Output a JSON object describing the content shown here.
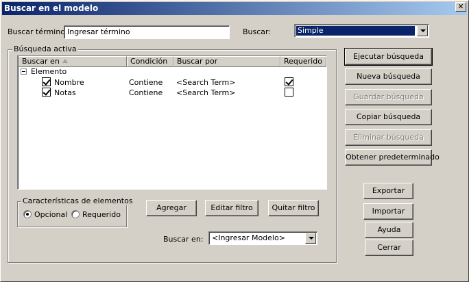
{
  "window": {
    "title": "Buscar en el modelo",
    "close_glyph": "✕"
  },
  "search": {
    "term_label": "Buscar término:",
    "term_value": "Ingresar término",
    "type_label": "Buscar:",
    "type_value": "Simple"
  },
  "active_search": {
    "title": "Búsqueda activa",
    "columns": [
      "Buscar en",
      "Condición",
      "Buscar por",
      "Requerido"
    ],
    "root": {
      "label": "Elemento",
      "expanded": true
    },
    "rows": [
      {
        "field": "Nombre",
        "checked": true,
        "condition": "Contiene",
        "search_by": "<Search Term>",
        "required": true
      },
      {
        "field": "Notas",
        "checked": true,
        "condition": "Contiene",
        "search_by": "<Search Term>",
        "required": false
      }
    ]
  },
  "element_features": {
    "title": "Características de elementos",
    "options": [
      "Opcional",
      "Requerido"
    ],
    "selected": "Opcional"
  },
  "filter_buttons": {
    "add": "Agregar",
    "edit": "Editar filtro",
    "remove": "Quitar filtro"
  },
  "search_in": {
    "label": "Buscar en:",
    "value": "<Ingresar Modelo>"
  },
  "actions": {
    "run": "Ejecutar búsqueda",
    "new": "Nueva búsqueda",
    "save": "Guardar búsqueda",
    "copy": "Copiar  búsqueda",
    "delete": "Eliminar búsqueda",
    "default": "Obtener predeterminado",
    "export": "Exportar",
    "import": "Importar",
    "help": "Ayuda",
    "close": "Cerrar"
  }
}
